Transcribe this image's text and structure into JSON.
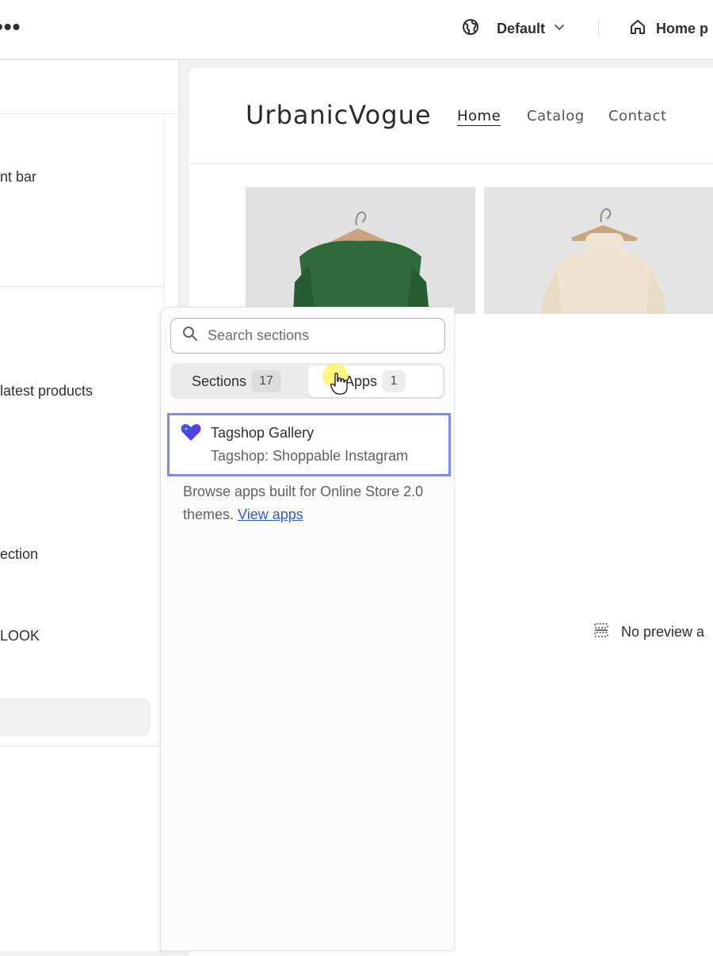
{
  "topbar": {
    "more_glyph": "•••",
    "theme": {
      "label": "Default"
    },
    "page": {
      "label": "Home p"
    }
  },
  "sidebar": {
    "items": [
      {
        "label": "nt bar"
      },
      {
        "label": " latest products"
      },
      {
        "label": "ection"
      },
      {
        "label": "LOOK"
      }
    ]
  },
  "store": {
    "brand": "UrbanicVogue",
    "nav": [
      {
        "label": "Home",
        "active": true
      },
      {
        "label": "Catalog",
        "active": false
      },
      {
        "label": "Contact",
        "active": false
      }
    ]
  },
  "popover": {
    "search": {
      "placeholder": "Search sections"
    },
    "tabs": [
      {
        "label": "Sections",
        "count": "17",
        "selected": false
      },
      {
        "label": "Apps",
        "count": "1",
        "selected": true
      }
    ],
    "app": {
      "name": "Tagshop Gallery",
      "subtitle": "Tagshop: Shoppable Instagram"
    },
    "browse": {
      "text": "Browse apps built for Online Store 2.0 themes.",
      "link": "View apps"
    }
  },
  "preview": {
    "message": "No preview a"
  },
  "colors": {
    "selection_border": "#7f8af0",
    "link": "#2c5fcc",
    "cursor_highlight": "#faf56e"
  }
}
